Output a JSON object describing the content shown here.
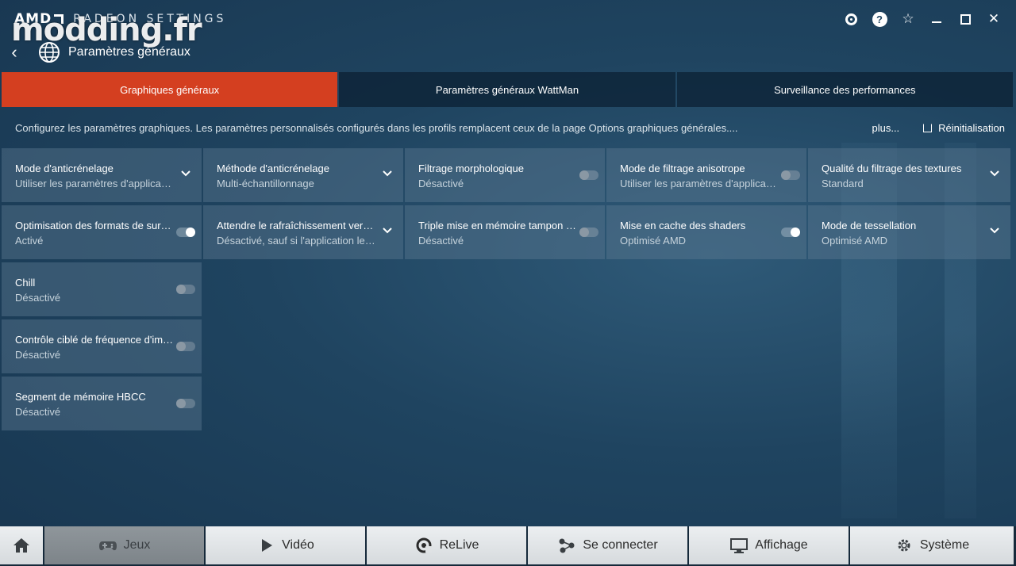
{
  "app": {
    "brand_amd": "AMD",
    "brand_settings": "RADEON SETTINGS",
    "watermark": "modding.fr"
  },
  "header": {
    "title": "Paramètres généraux"
  },
  "tabs": [
    {
      "label": "Graphiques généraux",
      "active": true
    },
    {
      "label": "Paramètres généraux WattMan",
      "active": false
    },
    {
      "label": "Surveillance des performances",
      "active": false
    }
  ],
  "description": {
    "text": "Configurez les paramètres graphiques. Les paramètres personnalisés configurés dans les profils remplacent ceux de la page Options graphiques générales....",
    "more_label": "plus...",
    "reset_label": "Réinitialisation"
  },
  "settings": [
    {
      "title": "Mode d'anticrénelage",
      "value": "Utiliser les paramètres d'application",
      "control": "dropdown"
    },
    {
      "title": "Méthode d'anticrénelage",
      "value": "Multi-échantillonnage",
      "control": "dropdown"
    },
    {
      "title": "Filtrage morphologique",
      "value": "Désactivé",
      "control": "toggle",
      "on": false
    },
    {
      "title": "Mode de filtrage anisotrope",
      "value": "Utiliser les paramètres d'application",
      "control": "toggle",
      "on": false
    },
    {
      "title": "Qualité du filtrage des textures",
      "value": "Standard",
      "control": "dropdown"
    },
    {
      "title": "Optimisation des formats de surface",
      "value": "Activé",
      "control": "toggle",
      "on": true
    },
    {
      "title": "Attendre le rafraîchissement vertical",
      "value": "Désactivé, sauf si l'application le s...",
      "control": "dropdown"
    },
    {
      "title": "Triple mise en mémoire tampon d'...",
      "value": "Désactivé",
      "control": "toggle",
      "on": false
    },
    {
      "title": "Mise en cache des shaders",
      "value": "Optimisé AMD",
      "control": "toggle",
      "on": true
    },
    {
      "title": "Mode de tessellation",
      "value": "Optimisé AMD",
      "control": "dropdown"
    },
    {
      "title": "Chill",
      "value": "Désactivé",
      "control": "toggle",
      "on": false
    },
    {
      "title": "Contrôle ciblé de fréquence d'image",
      "value": "Désactivé",
      "control": "toggle",
      "on": false
    },
    {
      "title": "Segment de mémoire HBCC",
      "value": "Désactivé",
      "control": "toggle",
      "on": false
    }
  ],
  "navbar": [
    {
      "label": "",
      "icon": "home-icon",
      "selected": false
    },
    {
      "label": "Jeux",
      "icon": "gamepad-icon",
      "selected": true
    },
    {
      "label": "Vidéo",
      "icon": "play-icon",
      "selected": false
    },
    {
      "label": "ReLive",
      "icon": "relive-icon",
      "selected": false
    },
    {
      "label": "Se connecter",
      "icon": "connect-icon",
      "selected": false
    },
    {
      "label": "Affichage",
      "icon": "monitor-icon",
      "selected": false
    },
    {
      "label": "Système",
      "icon": "gear-icon",
      "selected": false
    }
  ],
  "colors": {
    "accent": "#d43f20",
    "background": "#1f4460",
    "tile": "#5f7d94"
  }
}
